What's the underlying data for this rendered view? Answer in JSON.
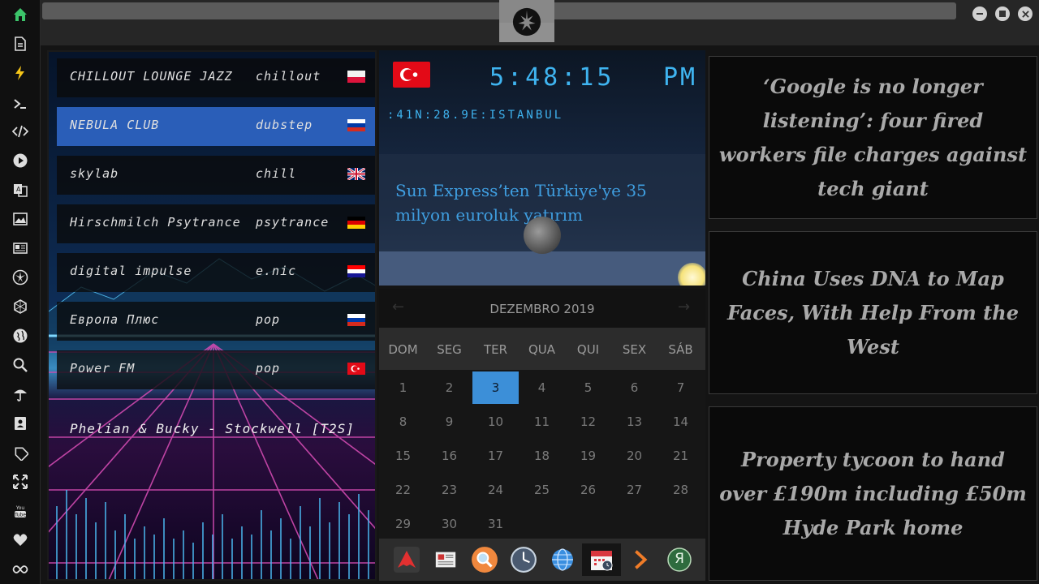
{
  "sidebar": {
    "icons": [
      "home-icon",
      "document-icon",
      "bolt-icon",
      "terminal-icon",
      "code-icon",
      "play-icon",
      "translate-icon",
      "image-icon",
      "news-icon",
      "rebel-icon",
      "hexagon-icon",
      "globe-icon",
      "search-icon",
      "umbrella-icon",
      "contacts-icon",
      "tag-icon",
      "expand-icon",
      "youtube-icon",
      "heart-icon",
      "infinity-icon"
    ],
    "youtube_label": "You Tube"
  },
  "radio": {
    "stations": [
      {
        "name": "CHILLOUT LOUNGE JAZZ",
        "genre": "chillout",
        "flag": "poland",
        "active": false
      },
      {
        "name": "NEBULA CLUB",
        "genre": "dubstep",
        "flag": "russia",
        "active": true
      },
      {
        "name": "skylab",
        "genre": "chill",
        "flag": "uk",
        "active": false
      },
      {
        "name": "Hirschmilch Psytrance",
        "genre": "psytrance",
        "flag": "germany",
        "active": false
      },
      {
        "name": "digital impulse",
        "genre": "e.nic",
        "flag": "croatia",
        "active": false
      },
      {
        "name": "Европа Плюс",
        "genre": "pop",
        "flag": "russia",
        "active": false
      },
      {
        "name": "Power FM",
        "genre": "pop",
        "flag": "turkey",
        "active": false
      }
    ],
    "now_playing": "Phelian & Bucky - Stockwell [T2S]"
  },
  "clock": {
    "time": "5:48:15",
    "ampm": "PM",
    "location": ":41N:28.9E:ISTANBUL",
    "news": "Sun Express’ten Türkiye'ye 35 milyon euroluk yatırım",
    "flag": "turkey"
  },
  "calendar": {
    "title": "DEZEMBRO 2019",
    "prev": "←",
    "next": "→",
    "weekdays": [
      "DOM",
      "SEG",
      "TER",
      "QUA",
      "QUI",
      "SEX",
      "SÁB"
    ],
    "today": 3,
    "days": [
      "1",
      "2",
      "3",
      "4",
      "5",
      "6",
      "7",
      "8",
      "9",
      "10",
      "11",
      "12",
      "13",
      "14",
      "15",
      "16",
      "17",
      "18",
      "19",
      "20",
      "21",
      "22",
      "23",
      "24",
      "25",
      "26",
      "27",
      "28",
      "29",
      "30",
      "31"
    ]
  },
  "dock": {
    "icons": [
      "arch-icon",
      "newspaper-icon",
      "magnifier-icon",
      "clock-icon",
      "globe-icon",
      "calendar-icon",
      "forward-icon",
      "yandex-icon"
    ],
    "yandex_letter": "Я"
  },
  "news": [
    "‘Google is no longer listening’: four fired workers file charges against tech giant",
    "China Uses DNA to Map Faces, With Help From the West",
    "Property tycoon to hand over £190m including £50m Hyde Park home"
  ],
  "colors": {
    "accent": "#3fb4f0",
    "active_station": "#2a5eb8",
    "today": "#3c8fd8",
    "home_icon": "#3cc46a",
    "bolt_icon": "#f5c518"
  }
}
